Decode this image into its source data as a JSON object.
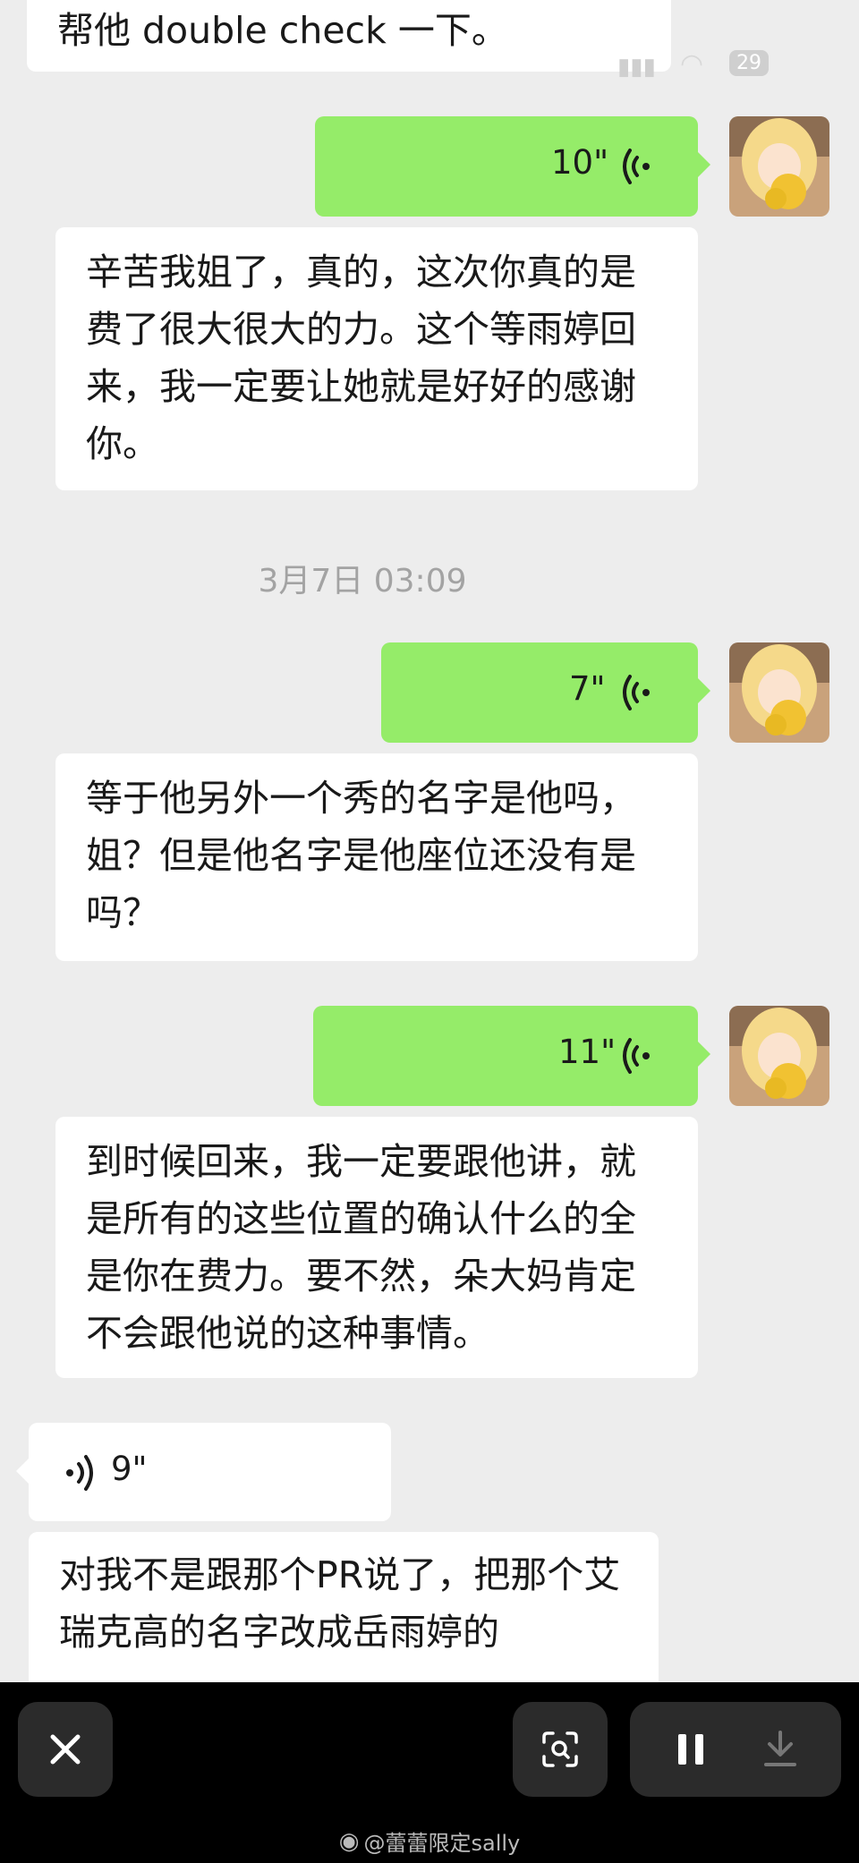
{
  "status_bar": {
    "battery": "29"
  },
  "messages": {
    "top_partial": "帮他 double check 一下。",
    "voice1_duration": "10\"",
    "reply1": "辛苦我姐了，真的，这次你真的是费了很大很大的力。这个等雨婷回来，我一定要让她就是好好的感谢你。",
    "timestamp": "3月7日 03:09",
    "voice2_duration": "7\"",
    "reply2": "等于他另外一个秀的名字是他吗，姐？但是他名字是他座位还没有是吗？",
    "voice3_duration": "11\"",
    "reply3": "到时候回来，我一定要跟他讲，就是所有的这些位置的确认什么的全是你在费力。要不然，朵大妈肯定不会跟他说的这种事情。",
    "voice4_duration": "9\"",
    "reply4_partial": "对我不是跟那个PR说了，把那个艾瑞克高的名字改成岳雨婷的"
  },
  "bottom_bar": {
    "close_icon": "close-icon",
    "scan_icon": "scan-search-icon",
    "pause_icon": "pause-icon",
    "download_icon": "download-icon"
  },
  "watermark": {
    "text": "@蕾蕾限定sally"
  },
  "colors": {
    "background": "#ededed",
    "green_bubble": "#95ec69",
    "white_bubble": "#ffffff",
    "bar": "#000000"
  }
}
